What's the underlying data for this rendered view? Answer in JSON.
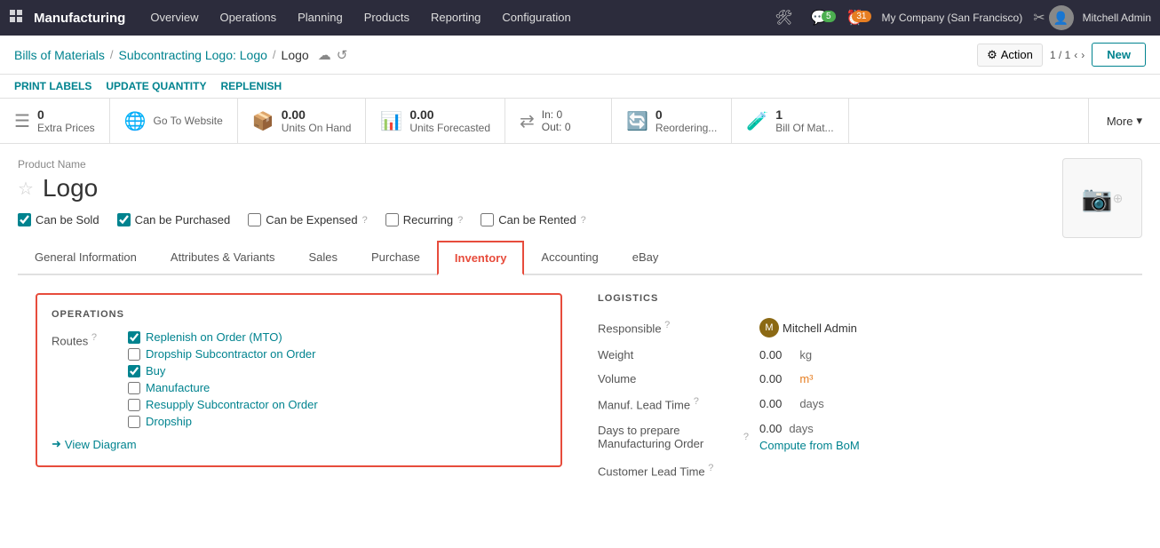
{
  "app": {
    "name": "Manufacturing",
    "nav_items": [
      "Overview",
      "Operations",
      "Planning",
      "Products",
      "Reporting",
      "Configuration"
    ]
  },
  "topbar": {
    "chat_count": "5",
    "activity_count": "31",
    "company": "My Company (San Francisco)",
    "user": "Mitchell Admin"
  },
  "breadcrumb": {
    "parent1": "Bills of Materials",
    "parent2": "Subcontracting Logo: Logo",
    "current": "Logo",
    "action_label": "Action",
    "pagination": "1 / 1",
    "new_label": "New"
  },
  "action_bar": {
    "print_labels": "PRINT LABELS",
    "update_quantity": "UPDATE QUANTITY",
    "replenish": "REPLENISH"
  },
  "stats": {
    "extra_prices": {
      "count": "0",
      "label": "Extra Prices"
    },
    "go_to_website": {
      "label": "Go To Website"
    },
    "on_hand": {
      "value": "0.00",
      "label": "Units On Hand"
    },
    "forecasted": {
      "value": "0.00",
      "label": "Units Forecasted"
    },
    "in_out": {
      "in": "0",
      "out": "0",
      "in_label": "In:",
      "out_label": "Out:"
    },
    "reordering": {
      "count": "0",
      "label": "Reordering..."
    },
    "bom": {
      "count": "1",
      "label": "Bill Of Mat..."
    },
    "more": "More"
  },
  "product": {
    "name_label": "Product Name",
    "name": "Logo",
    "image_placeholder": "📷"
  },
  "checkboxes": {
    "can_be_sold": {
      "label": "Can be Sold",
      "checked": true
    },
    "can_be_purchased": {
      "label": "Can be Purchased",
      "checked": true
    },
    "can_be_expensed": {
      "label": "Can be Expensed",
      "checked": false
    },
    "recurring": {
      "label": "Recurring",
      "checked": false
    },
    "can_be_rented": {
      "label": "Can be Rented",
      "checked": false
    }
  },
  "tabs": [
    {
      "id": "general",
      "label": "General Information"
    },
    {
      "id": "attributes",
      "label": "Attributes & Variants"
    },
    {
      "id": "sales",
      "label": "Sales"
    },
    {
      "id": "purchase",
      "label": "Purchase"
    },
    {
      "id": "inventory",
      "label": "Inventory",
      "active": true
    },
    {
      "id": "accounting",
      "label": "Accounting"
    },
    {
      "id": "ebay",
      "label": "eBay"
    }
  ],
  "operations": {
    "section_title": "OPERATIONS",
    "routes_label": "Routes",
    "help_icon": "?",
    "routes": [
      {
        "id": "mto",
        "label": "Replenish on Order (MTO)",
        "checked": true
      },
      {
        "id": "dropship_sub",
        "label": "Dropship Subcontractor on Order",
        "checked": false
      },
      {
        "id": "buy",
        "label": "Buy",
        "checked": true
      },
      {
        "id": "manufacture",
        "label": "Manufacture",
        "checked": false
      },
      {
        "id": "resupply_sub",
        "label": "Resupply Subcontractor on Order",
        "checked": false
      },
      {
        "id": "dropship",
        "label": "Dropship",
        "checked": false
      }
    ],
    "view_diagram": "View Diagram"
  },
  "logistics": {
    "section_title": "LOGISTICS",
    "responsible_label": "Responsible",
    "responsible_help": "?",
    "responsible_value": "Mitchell Admin",
    "weight_label": "Weight",
    "weight_value": "0.00",
    "weight_unit": "kg",
    "volume_label": "Volume",
    "volume_value": "0.00",
    "volume_unit": "m³",
    "manuf_lead_label": "Manuf. Lead Time",
    "manuf_lead_help": "?",
    "manuf_lead_value": "0.00",
    "manuf_lead_unit": "days",
    "days_to_prepare_label": "Days to prepare Manufacturing Order",
    "days_to_prepare_help": "?",
    "days_to_prepare_value": "0.00",
    "days_to_prepare_unit": "days",
    "compute_label": "Compute from BoM",
    "customer_lead_label": "Customer Lead Time",
    "customer_lead_help": "?"
  }
}
